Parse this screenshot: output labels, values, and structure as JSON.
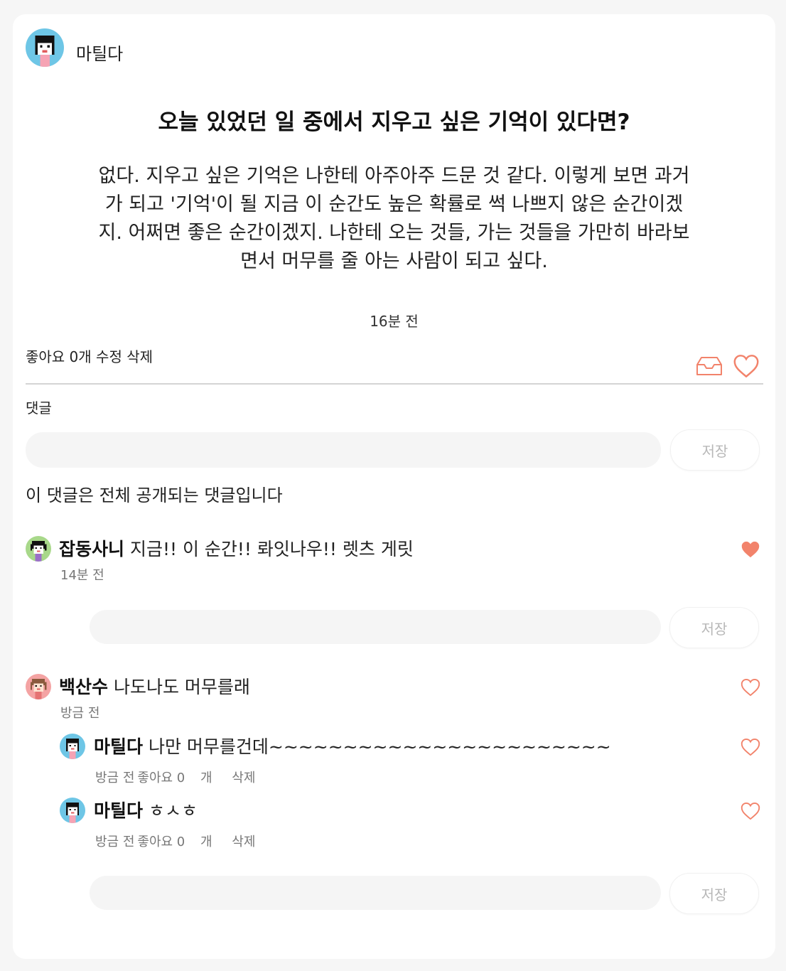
{
  "post": {
    "author": "마틸다",
    "question": "오늘 있었던 일 중에서 지우고 싶은 기억이 있다면?",
    "answer_lines": [
      "없다. 지우고 싶은 기억은 나한테 아주아주 드문 것 같다. 이렇게 보면 과거",
      "가 되고 '기억'이 될 지금 이 순간도 높은 확률로 썩 나쁘지 않은 순간이겠",
      "지. 어쩌면 좋은 순간이겠지. 나한테 오는 것들, 가는 것들을 가만히 바라보",
      "면서 머무를 줄 아는 사람이 되고 싶다."
    ],
    "time": "16분 전",
    "likes_label": "좋아요 0개",
    "edit_label": "수정",
    "delete_label": "삭제"
  },
  "comments_section": {
    "label": "댓글",
    "input_placeholder": "",
    "save_label": "저장",
    "public_note": "이 댓글은 전체 공개되는 댓글입니다"
  },
  "comments": [
    {
      "name": "잡동사니",
      "text": "지금!! 이 순간!! 롸잇나우!! 렛츠 게릿",
      "time": "14분 전",
      "liked": true,
      "reply_save_label": "저장"
    },
    {
      "name": "백산수",
      "text": "나도나도 머무를래",
      "time": "방금 전",
      "liked": false,
      "reply_save_label": "저장",
      "replies": [
        {
          "name": "마틸다",
          "text": "나만 머무를건데~~~~~~~~~~~~~~~~~~~~~~~",
          "time": "방금 전",
          "likes_label": "좋아요 0",
          "count_unit": "개",
          "delete_label": "삭제",
          "liked": false
        },
        {
          "name": "마틸다",
          "text": "ㅎㅅㅎ",
          "time": "방금 전",
          "likes_label": "좋아요 0",
          "count_unit": "개",
          "delete_label": "삭제",
          "liked": false
        }
      ]
    }
  ],
  "colors": {
    "accent": "#f2836b",
    "pill": "#f5f5f5",
    "divider": "#d4d4d4"
  },
  "icons": [
    "avatar-matilda",
    "avatar-japdongsani",
    "avatar-baeksansu",
    "inbox-icon",
    "heart-icon",
    "heart-filled-icon"
  ]
}
